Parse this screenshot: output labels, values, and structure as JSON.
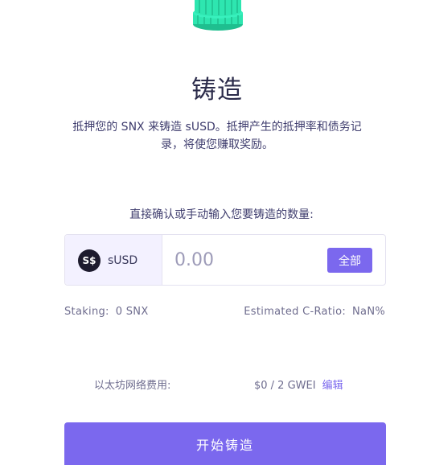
{
  "header": {
    "illustration_icon": "coin-stack-icon",
    "title": "铸造",
    "description": "抵押您的 SNX 来铸造 sUSD。抵押产生的抵押率和债务记录，将使您赚取奖励。"
  },
  "mint_form": {
    "prompt": "直接确认或手动输入您要铸造的数量:",
    "token": {
      "icon": "susd-token-icon",
      "icon_glyph": "S$",
      "name": "sUSD"
    },
    "amount": {
      "value": "",
      "placeholder": "0.00"
    },
    "max_label": "全部"
  },
  "stats": {
    "staking_label": "Staking:",
    "staking_value": "0 SNX",
    "cratio_label": "Estimated C-Ratio:",
    "cratio_value": "NaN%"
  },
  "fee": {
    "label": "以太坊网络费用:",
    "value": "$0 / 2 GWEI",
    "edit_label": "编辑"
  },
  "actions": {
    "submit_label": "开始铸造"
  },
  "colors": {
    "accent": "#7b68ee",
    "coin": "#2ee6b0",
    "token_bg": "#1d1b2e"
  }
}
